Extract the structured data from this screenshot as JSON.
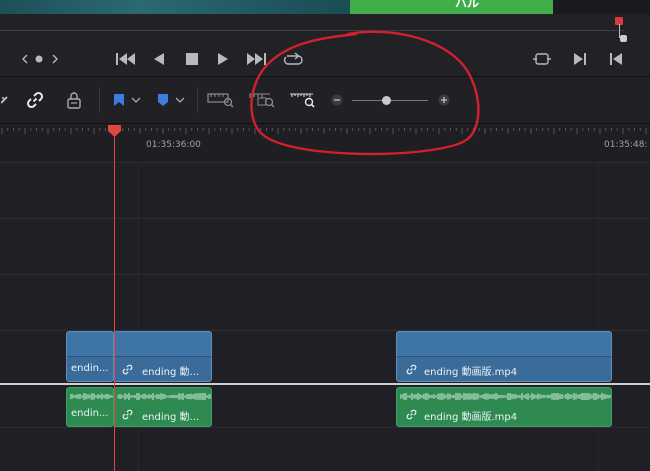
{
  "viewer": {
    "overlay_text": "ハル"
  },
  "transport": {
    "icons": [
      "chevron-left-icon",
      "dot-icon",
      "chevron-right-icon",
      "skip-start-icon",
      "play-reverse-icon",
      "stop-icon",
      "play-icon",
      "skip-end-icon",
      "loop-icon",
      "transform-icon",
      "next-clip-icon",
      "prev-clip-icon"
    ]
  },
  "toolbar": {
    "icons": [
      "blade-icon",
      "link-icon",
      "position-lock-icon",
      "flag-blue-icon",
      "dropdown-icon",
      "marker-blue-icon",
      "dropdown-icon",
      "zoom-full-icon",
      "zoom-detail-icon",
      "zoom-custom-icon",
      "zoom-minus-icon",
      "zoom-plus-icon"
    ],
    "zoom_level": 0.45
  },
  "ruler": {
    "timecodes": [
      "01:35:36:00",
      "01:35:48:"
    ]
  },
  "tracks": {
    "video_clips": [
      {
        "label": "endin..."
      },
      {
        "label": "ending 動..."
      },
      {
        "label": "ending 動画版.mp4"
      }
    ],
    "audio_clips": [
      {
        "label": "endin..."
      },
      {
        "label": "ending 動..."
      },
      {
        "label": "ending 動画版.mp4"
      }
    ]
  },
  "colors": {
    "video_clip": "#3e74a6",
    "audio_clip": "#2f8a52",
    "playhead": "#e0483f",
    "annotation": "#d3202d"
  }
}
